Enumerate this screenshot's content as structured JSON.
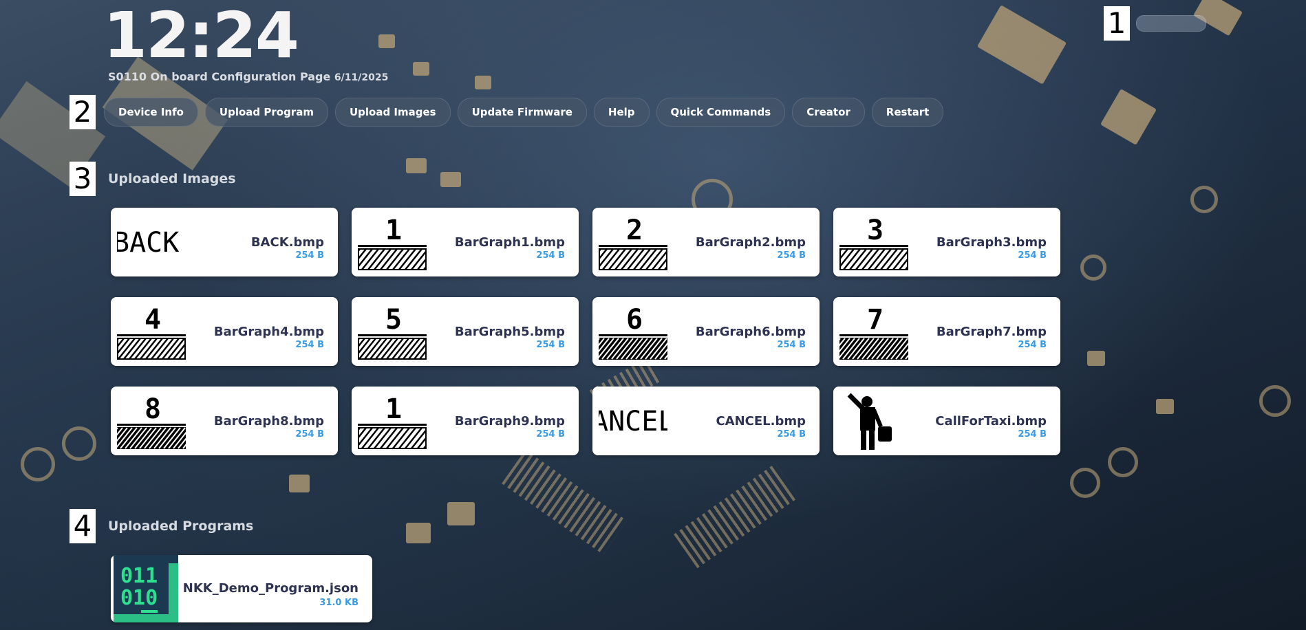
{
  "clock": {
    "time": "12:24"
  },
  "header": {
    "title": "S0110 On board Configuration Page",
    "date": "6/11/2025"
  },
  "markers": [
    "1",
    "2",
    "3",
    "4"
  ],
  "nav": {
    "items": [
      {
        "label": "Device Info"
      },
      {
        "label": "Upload Program"
      },
      {
        "label": "Upload Images"
      },
      {
        "label": "Update Firmware"
      },
      {
        "label": "Help"
      },
      {
        "label": "Quick Commands"
      },
      {
        "label": "Creator"
      },
      {
        "label": "Restart"
      }
    ]
  },
  "images_section": {
    "title": "Uploaded Images",
    "items": [
      {
        "name": "BACK.bmp",
        "size": "254 B",
        "thumb_text": "BACK"
      },
      {
        "name": "BarGraph1.bmp",
        "size": "254 B",
        "thumb_text": "1"
      },
      {
        "name": "BarGraph2.bmp",
        "size": "254 B",
        "thumb_text": "2"
      },
      {
        "name": "BarGraph3.bmp",
        "size": "254 B",
        "thumb_text": "3"
      },
      {
        "name": "BarGraph4.bmp",
        "size": "254 B",
        "thumb_text": "4"
      },
      {
        "name": "BarGraph5.bmp",
        "size": "254 B",
        "thumb_text": "5"
      },
      {
        "name": "BarGraph6.bmp",
        "size": "254 B",
        "thumb_text": "6"
      },
      {
        "name": "BarGraph7.bmp",
        "size": "254 B",
        "thumb_text": "7"
      },
      {
        "name": "BarGraph8.bmp",
        "size": "254 B",
        "thumb_text": "8"
      },
      {
        "name": "BarGraph9.bmp",
        "size": "254 B",
        "thumb_text": "1"
      },
      {
        "name": "CANCEL.bmp",
        "size": "254 B",
        "thumb_text": "ANCEL"
      },
      {
        "name": "CallForTaxi.bmp",
        "size": "254 B",
        "thumb_text": ""
      }
    ]
  },
  "programs_section": {
    "title": "Uploaded Programs",
    "items": [
      {
        "name": "NKK_Demo_Program.json",
        "size": "31.0 KB",
        "icon_line1": "011",
        "icon_line2": "010"
      }
    ]
  },
  "colors": {
    "accent": "#3a9be0",
    "card_text": "#2d3350",
    "icon_bg": "#1b3a52",
    "icon_green": "#2ee08f"
  }
}
